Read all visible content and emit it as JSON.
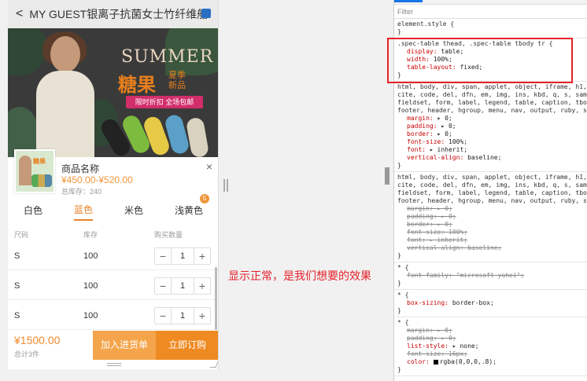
{
  "phone": {
    "back": "<",
    "title": "MY GUEST银离子抗菌女士竹纤维船袜",
    "banner": {
      "summer": "SUMMER",
      "candy": "糖果",
      "new": "夏季新品",
      "tag": "限时折扣 全场包邮"
    },
    "product": {
      "name": "商品名称",
      "price": "¥450.00-¥520.00",
      "stock": "总库存：240",
      "close": "×"
    },
    "colors": [
      "白色",
      "蓝色",
      "米色",
      "浅黄色"
    ],
    "active_color": "蓝色",
    "badge": "5",
    "table_headers": [
      "尺码",
      "库存",
      "购买数量"
    ],
    "rows": [
      {
        "size": "S",
        "stock": "100",
        "qty": "1"
      },
      {
        "size": "S",
        "stock": "100",
        "qty": "1"
      },
      {
        "size": "S",
        "stock": "100",
        "qty": "1"
      }
    ],
    "minus": "−",
    "plus": "+",
    "total": "¥1500.00",
    "total_count": "总计3件",
    "add_button": "加入进货单",
    "buy_button": "立即订购"
  },
  "annotation": "显示正常，是我们想要的效果",
  "devtools": {
    "filter": "Filter",
    "element_style": "element.style {\n}",
    "rule1_selector": ".spec-table thead, .spec-table tbody tr {",
    "rule1_props": [
      {
        "name": "display",
        "value": "table;"
      },
      {
        "name": "width",
        "value": "100%;"
      },
      {
        "name": "table-layout",
        "value": "fixed;"
      }
    ],
    "rule2_selector": "html, body, div, span, applet, object, iframe, h1, h\ncite, code, del, dfn, em, img, ins, kbd, q, s, samp\nfieldset, form, label, legend, table, caption, tbod\nfooter, header, hgroup, menu, nav, output, ruby, sec",
    "rule2_props": [
      {
        "name": "margin",
        "value": "▸ 0;"
      },
      {
        "name": "padding",
        "value": "▸ 0;"
      },
      {
        "name": "border",
        "value": "▸ 0;"
      },
      {
        "name": "font-size",
        "value": "100%;"
      },
      {
        "name": "font",
        "value": "▸ inherit;"
      },
      {
        "name": "vertical-align",
        "value": "baseline;"
      }
    ],
    "rule3_props": [
      {
        "name": "margin",
        "value": "▸ 0;"
      },
      {
        "name": "padding",
        "value": "▸ 0;"
      },
      {
        "name": "border",
        "value": "▸ 0;"
      },
      {
        "name": "font-size",
        "value": "100%;"
      },
      {
        "name": "font",
        "value": "▸ inherit;"
      },
      {
        "name": "vertical-align",
        "value": "baseline;"
      }
    ],
    "rule4_selector": "* {",
    "rule4_prop": {
      "name": "font-family",
      "value": "\"microsoft yahei\";"
    },
    "rule5_selector": "* {",
    "rule5_prop": {
      "name": "box-sizing",
      "value": "border-box;"
    },
    "rule6_selector": "* {",
    "rule6_props": [
      {
        "name": "margin",
        "value": "▸ 0;",
        "struck": true
      },
      {
        "name": "padding",
        "value": "▸ 0;",
        "struck": true
      },
      {
        "name": "list-style",
        "value": "▸ none;",
        "struck": false
      },
      {
        "name": "font-size",
        "value": "16px;",
        "struck": true
      },
      {
        "name": "color",
        "value": "rgba(0,0,0,.8);",
        "struck": false
      }
    ],
    "close_brace": "}"
  },
  "colors": {
    "accent_orange": "#ef8a22",
    "annotation_red": "#e5222a",
    "css_property": "#c80000"
  }
}
